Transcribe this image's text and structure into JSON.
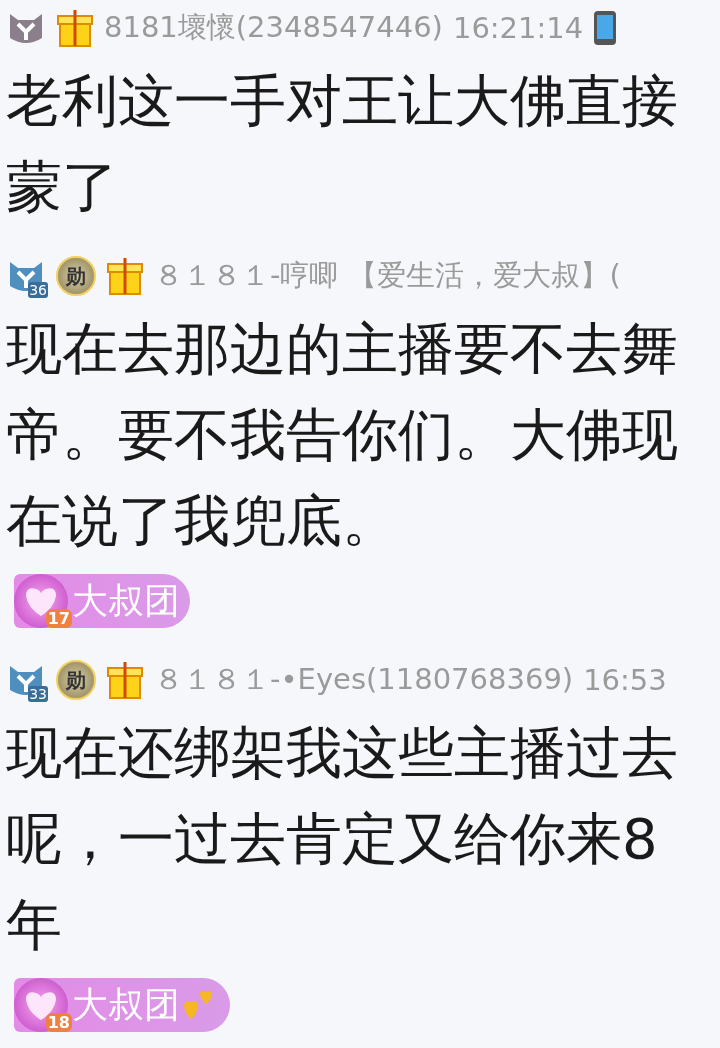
{
  "messages": [
    {
      "level_badge": {
        "color": "#8a7f8a"
      },
      "name": "8181壞懷(2348547446)",
      "time": "16:21:14",
      "phone": true,
      "text": "老利这一手对王让大佛直接蒙了"
    },
    {
      "level_badge": {
        "color": "#4f8fc0",
        "number": "36"
      },
      "medal": {
        "char": "勋"
      },
      "name": "８１８１-哼唧",
      "tag": "【爱生活，爱大叔】(",
      "phone": false,
      "text": "现在去那边的主播要不去舞帝。要不我告你们。大佛现在说了我兜底。",
      "fan_badge": {
        "label": "大叔团",
        "level": "17",
        "hearts": false
      }
    },
    {
      "level_badge": {
        "color": "#4f8fc0",
        "number": "33"
      },
      "medal": {
        "char": "勋"
      },
      "name": "８１８１-•Eyes(1180768369)",
      "time": "16:53",
      "phone": false,
      "text": "现在还绑架我这些主播过去呢，一过去肯定又给你来8年",
      "fan_badge": {
        "label": "大叔团",
        "level": "18",
        "hearts": true
      }
    }
  ]
}
